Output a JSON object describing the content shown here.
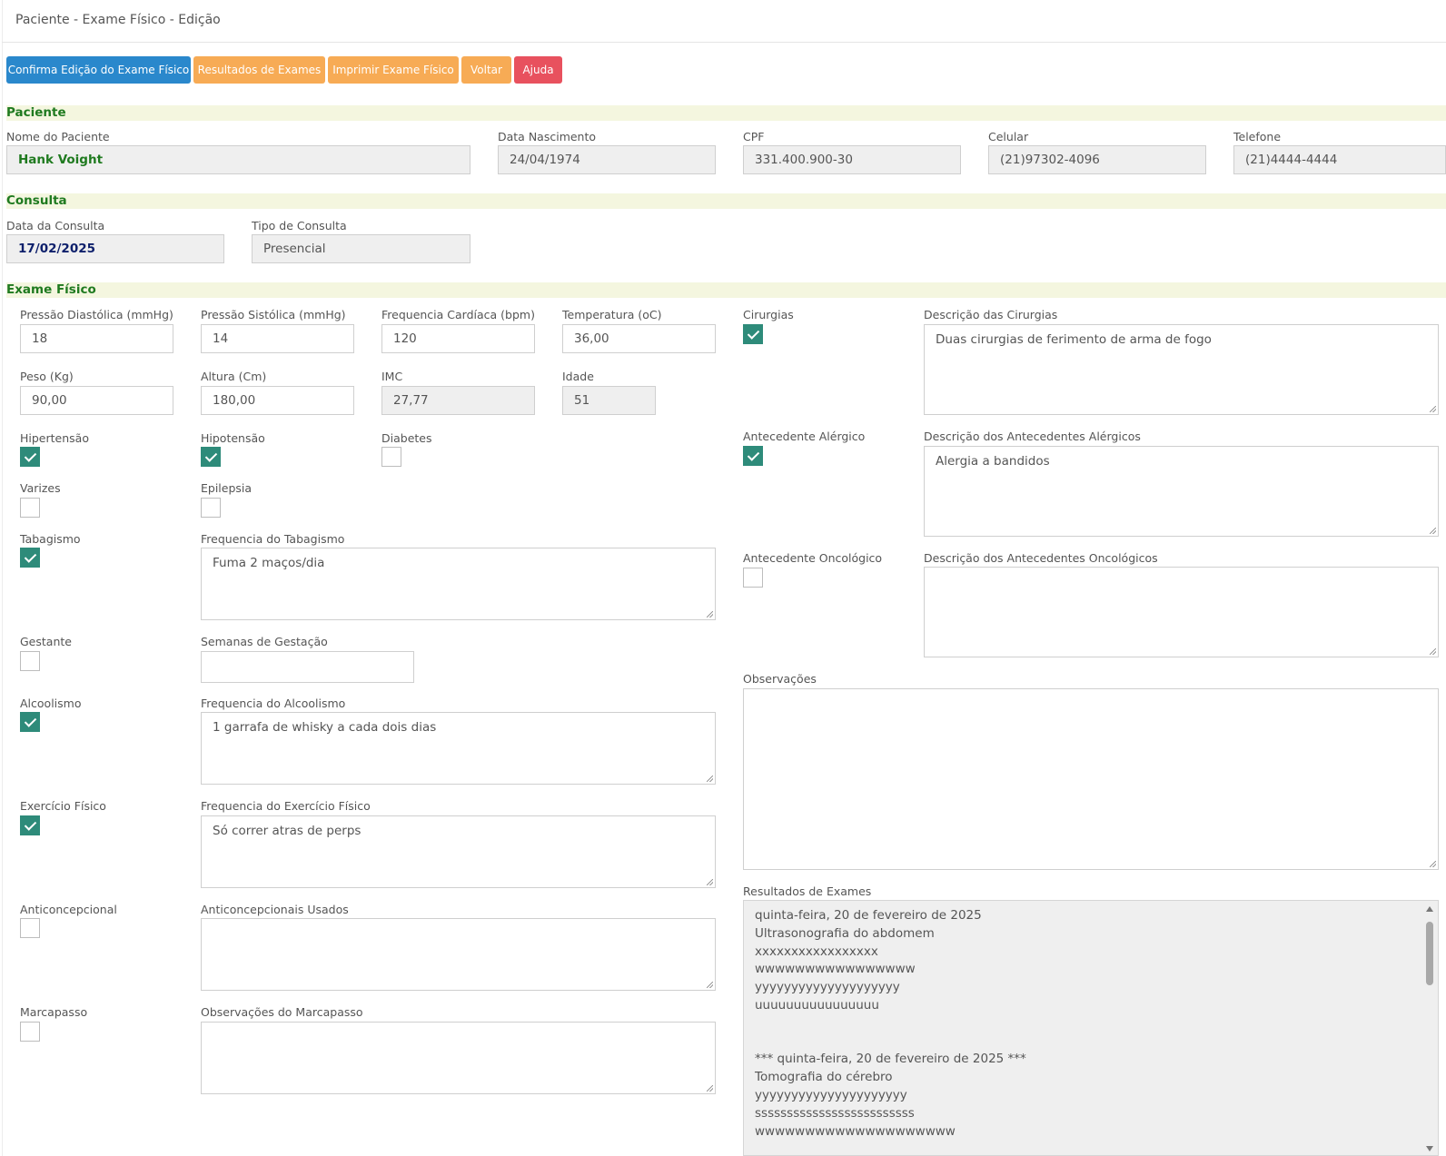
{
  "page": {
    "title": "Paciente - Exame Físico - Edição"
  },
  "toolbar": {
    "confirm_label": "Confirma Edição do Exame Físico",
    "results_label": "Resultados de Exames",
    "print_label": "Imprimir Exame Físico",
    "back_label": "Voltar",
    "help_label": "Ajuda"
  },
  "paciente": {
    "section_title": "Paciente",
    "nome_label": "Nome do Paciente",
    "nome_value": "Hank Voight",
    "nascimento_label": "Data Nascimento",
    "nascimento_value": "24/04/1974",
    "cpf_label": "CPF",
    "cpf_value": "331.400.900-30",
    "celular_label": "Celular",
    "celular_value": "(21)97302-4096",
    "telefone_label": "Telefone",
    "telefone_value": "(21)4444-4444"
  },
  "consulta": {
    "section_title": "Consulta",
    "data_label": "Data da Consulta",
    "data_value": "17/02/2025",
    "tipo_label": "Tipo de Consulta",
    "tipo_value": "Presencial"
  },
  "exame": {
    "section_title": "Exame Físico",
    "diastolica_label": "Pressão Diastólica (mmHg)",
    "diastolica_value": "18",
    "sistolica_label": "Pressão Sistólica (mmHg)",
    "sistolica_value": "14",
    "freq_cardiaca_label": "Frequencia Cardíaca (bpm)",
    "freq_cardiaca_value": "120",
    "temperatura_label": "Temperatura (oC)",
    "temperatura_value": "36,00",
    "peso_label": "Peso (Kg)",
    "peso_value": "90,00",
    "altura_label": "Altura (Cm)",
    "altura_value": "180,00",
    "imc_label": "IMC",
    "imc_value": "27,77",
    "idade_label": "Idade",
    "idade_value": "51",
    "hipertensao_label": "Hipertensão",
    "hipertensao_checked": true,
    "hipotensao_label": "Hipotensão",
    "hipotensao_checked": true,
    "diabetes_label": "Diabetes",
    "diabetes_checked": false,
    "varizes_label": "Varizes",
    "varizes_checked": false,
    "epilepsia_label": "Epilepsia",
    "epilepsia_checked": false,
    "tabagismo_label": "Tabagismo",
    "tabagismo_checked": true,
    "freq_tabagismo_label": "Frequencia do Tabagismo",
    "freq_tabagismo_value": "Fuma 2 maços/dia",
    "gestante_label": "Gestante",
    "gestante_checked": false,
    "semanas_label": "Semanas de Gestação",
    "semanas_value": "",
    "alcoolismo_label": "Alcoolismo",
    "alcoolismo_checked": true,
    "freq_alcoolismo_label": "Frequencia do Alcoolismo",
    "freq_alcoolismo_value": "1 garrafa de whisky a cada dois dias",
    "exercicio_label": "Exercício Físico",
    "exercicio_checked": true,
    "freq_exercicio_label": "Frequencia do Exercício Físico",
    "freq_exercicio_value": "Só correr atras de perps",
    "anticoncepcional_label": "Anticoncepcional",
    "anticoncepcional_checked": false,
    "anticoncepcionais_usados_label": "Anticoncepcionais Usados",
    "anticoncepcionais_usados_value": "",
    "marcapasso_label": "Marcapasso",
    "marcapasso_checked": false,
    "obs_marcapasso_label": "Observações do Marcapasso",
    "obs_marcapasso_value": "",
    "cirurgias_label": "Cirurgias",
    "cirurgias_checked": true,
    "desc_cirurgias_label": "Descrição das Cirurgias",
    "desc_cirurgias_value": "Duas cirurgias de ferimento de arma de fogo",
    "alergico_label": "Antecedente Alérgico",
    "alergico_checked": true,
    "desc_alergico_label": "Descrição dos Antecedentes Alérgicos",
    "desc_alergico_value": "Alergia a bandidos",
    "oncologico_label": "Antecedente Oncológico",
    "oncologico_checked": false,
    "desc_oncologico_label": "Descrição dos Antecedentes Oncológicos",
    "desc_oncologico_value": "",
    "observacoes_label": "Observações",
    "observacoes_value": "",
    "resultados_label": "Resultados de Exames",
    "resultados_value": "quinta-feira, 20 de fevereiro de 2025\nUltrasonografia do abdomem\nxxxxxxxxxxxxxxxxx\nwwwwwwwwwwwwwwww\nyyyyyyyyyyyyyyyyyyyy\nuuuuuuuuuuuuuuuu\n\n\n*** quinta-feira, 20 de fevereiro de 2025 ***\nTomografia do cérebro\nyyyyyyyyyyyyyyyyyyyyy\nsssssssssssssssssssssssss\nwwwwwwwwwwwwwwwwwwww"
  },
  "colors": {
    "primary": "#2a88cc",
    "warning": "#f7ab55",
    "danger": "#e8515e",
    "section_bg": "#f4f6df",
    "section_text": "#1f7a1f",
    "checkbox_checked": "#2e8b7a"
  }
}
